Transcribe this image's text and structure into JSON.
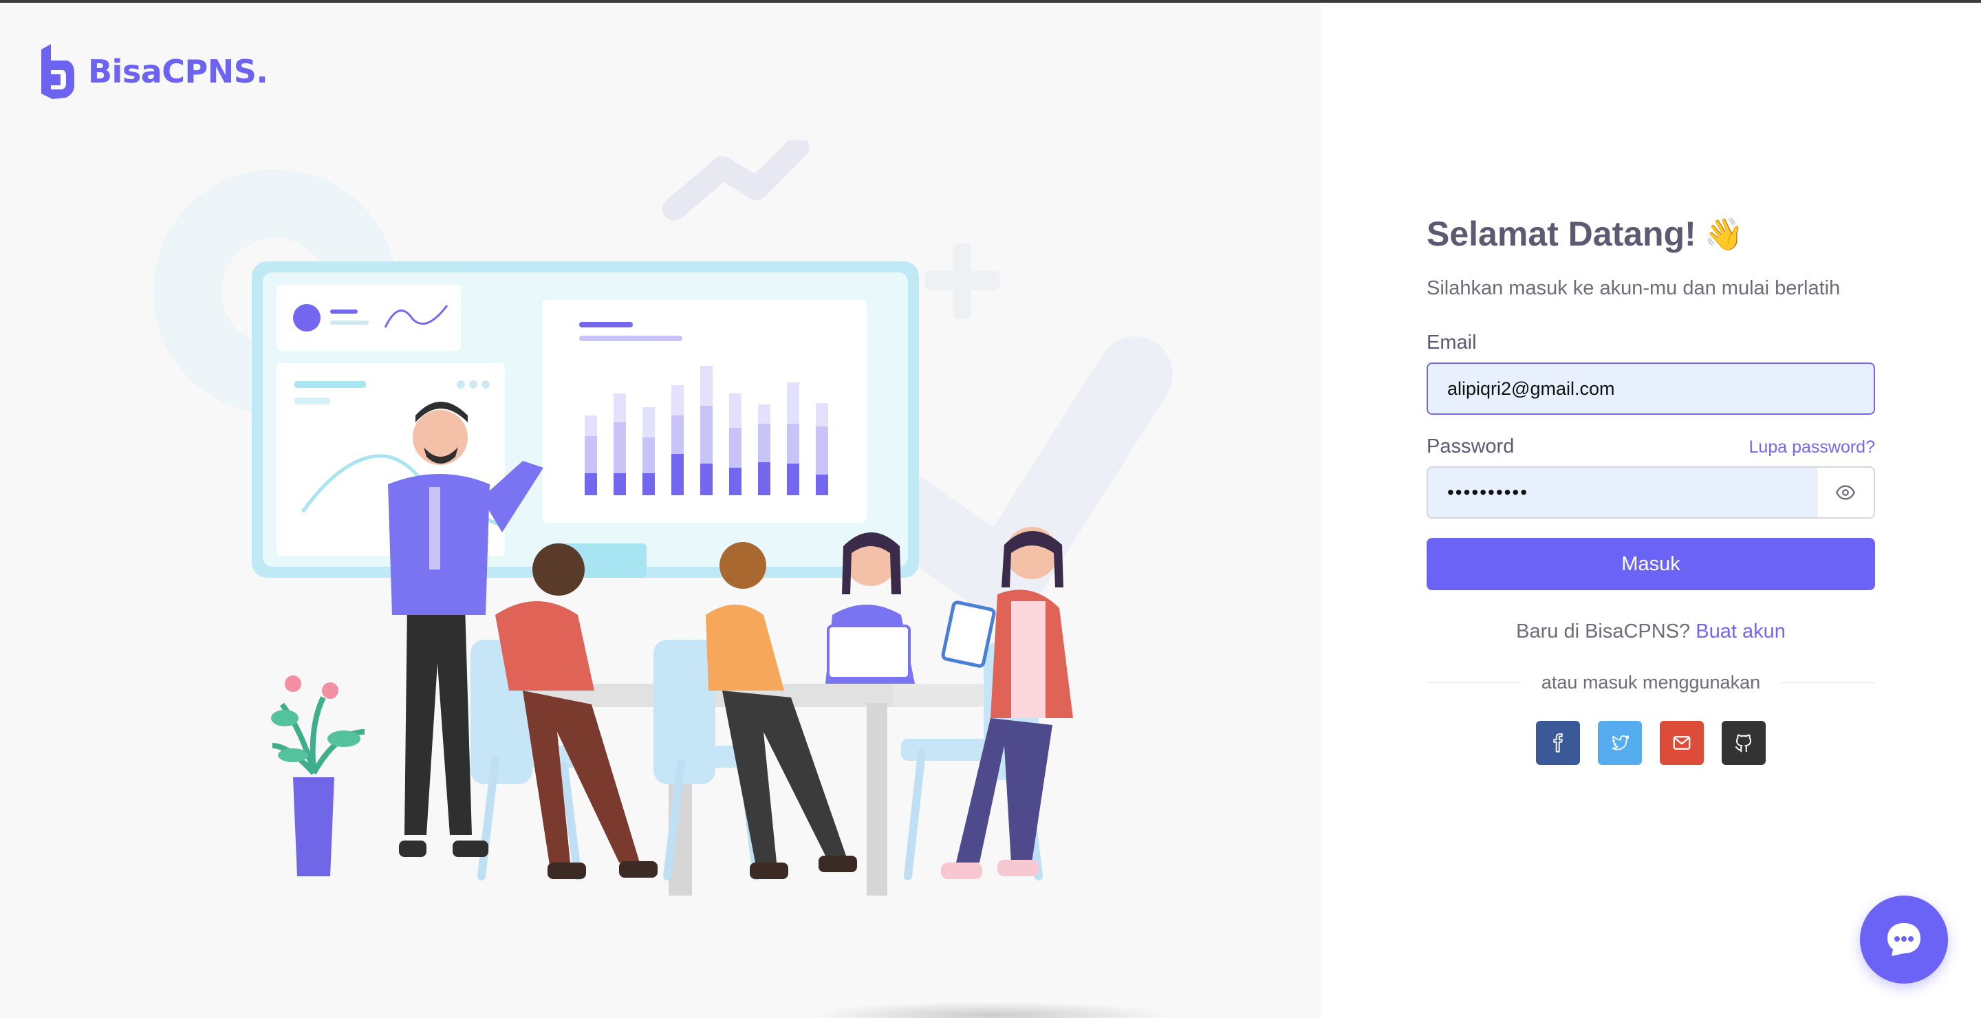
{
  "brand": {
    "name": "BisaCPNS."
  },
  "login": {
    "welcome_title": "Selamat Datang!",
    "welcome_emoji": "👋",
    "subtitle": "Silahkan masuk ke akun-mu dan mulai berlatih",
    "email_label": "Email",
    "email_value": "alipiqri2@gmail.com",
    "password_label": "Password",
    "forgot_link": "Lupa password?",
    "password_value": "••••••••••",
    "submit_label": "Masuk",
    "new_user_text": "Baru di BisaCPNS?",
    "create_account_link": "Buat akun",
    "divider_text": "atau masuk menggunakan"
  },
  "social": [
    {
      "name": "facebook",
      "color": "#3b5998"
    },
    {
      "name": "twitter",
      "color": "#55acee"
    },
    {
      "name": "google-mail",
      "color": "#dd4b39"
    },
    {
      "name": "github",
      "color": "#333333"
    }
  ],
  "colors": {
    "primary": "#7367f0",
    "button": "#6a63f5",
    "title": "#5e5873",
    "text": "#6e6b7b"
  }
}
